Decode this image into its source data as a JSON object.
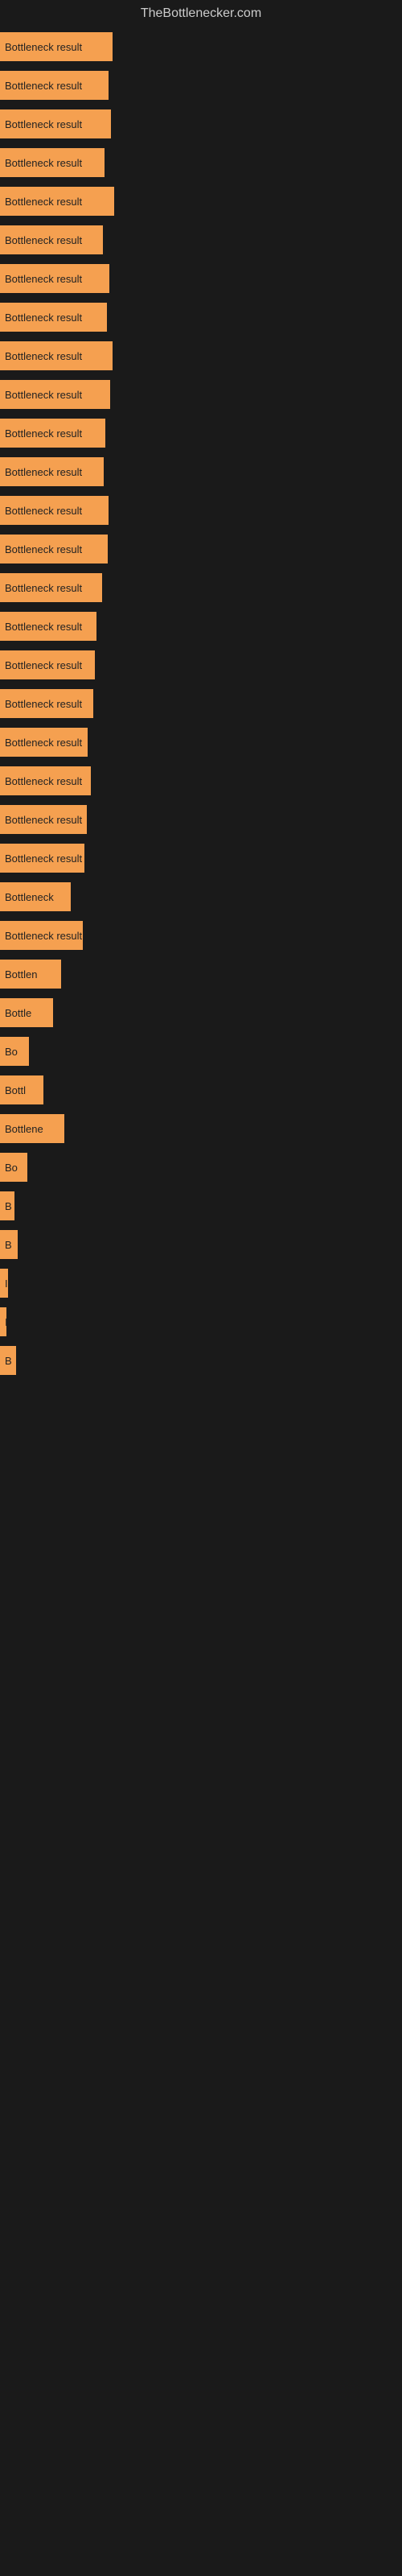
{
  "site": {
    "title": "TheBottlenecker.com"
  },
  "bars": [
    {
      "label": "Bottleneck result",
      "width": 140
    },
    {
      "label": "Bottleneck result",
      "width": 135
    },
    {
      "label": "Bottleneck result",
      "width": 138
    },
    {
      "label": "Bottleneck result",
      "width": 130
    },
    {
      "label": "Bottleneck result",
      "width": 142
    },
    {
      "label": "Bottleneck result",
      "width": 128
    },
    {
      "label": "Bottleneck result",
      "width": 136
    },
    {
      "label": "Bottleneck result",
      "width": 133
    },
    {
      "label": "Bottleneck result",
      "width": 140
    },
    {
      "label": "Bottleneck result",
      "width": 137
    },
    {
      "label": "Bottleneck result",
      "width": 131
    },
    {
      "label": "Bottleneck result",
      "width": 129
    },
    {
      "label": "Bottleneck result",
      "width": 135
    },
    {
      "label": "Bottleneck result",
      "width": 134
    },
    {
      "label": "Bottleneck result",
      "width": 127
    },
    {
      "label": "Bottleneck result",
      "width": 120
    },
    {
      "label": "Bottleneck result",
      "width": 118
    },
    {
      "label": "Bottleneck result",
      "width": 116
    },
    {
      "label": "Bottleneck result",
      "width": 109
    },
    {
      "label": "Bottleneck result",
      "width": 113
    },
    {
      "label": "Bottleneck result",
      "width": 108
    },
    {
      "label": "Bottleneck result",
      "width": 105
    },
    {
      "label": "Bottleneck",
      "width": 88
    },
    {
      "label": "Bottleneck result",
      "width": 103
    },
    {
      "label": "Bottlen",
      "width": 76
    },
    {
      "label": "Bottle",
      "width": 66
    },
    {
      "label": "Bo",
      "width": 36
    },
    {
      "label": "Bottl",
      "width": 54
    },
    {
      "label": "Bottlene",
      "width": 80
    },
    {
      "label": "Bo",
      "width": 34
    },
    {
      "label": "B",
      "width": 18
    },
    {
      "label": "B",
      "width": 22
    },
    {
      "label": "I",
      "width": 10
    },
    {
      "label": "I",
      "width": 8
    },
    {
      "label": "B",
      "width": 20
    }
  ]
}
